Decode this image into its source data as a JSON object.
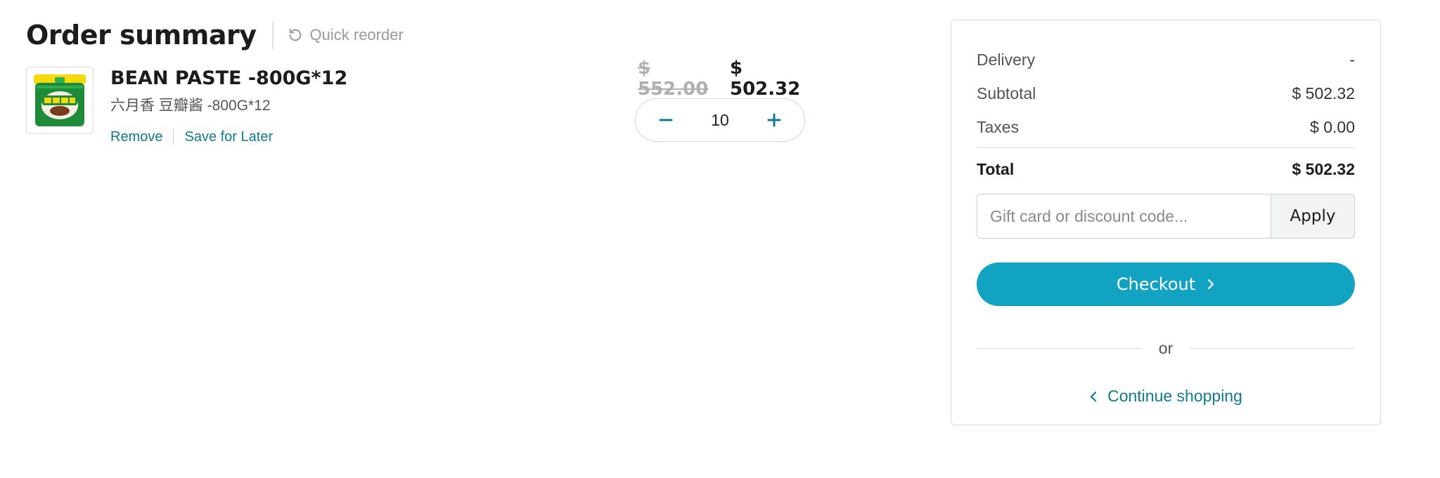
{
  "header": {
    "title": "Order summary",
    "quick_reorder_label": "Quick reorder",
    "reorder_icon": "refresh-icon"
  },
  "cart_items": [
    {
      "name": "BEAN PASTE -800G*12",
      "subtitle": "六月香 豆瓣酱 -800G*12",
      "original_price": "$ 552.00",
      "price": "$ 502.32",
      "quantity": "10",
      "remove_label": "Remove",
      "save_label": "Save for Later",
      "decrement_icon": "minus-icon",
      "increment_icon": "plus-icon"
    }
  ],
  "summary": {
    "delivery_label": "Delivery",
    "delivery_value": "-",
    "subtotal_label": "Subtotal",
    "subtotal_value": "$ 502.32",
    "taxes_label": "Taxes",
    "taxes_value": "$ 0.00",
    "total_label": "Total",
    "total_value": "$ 502.32",
    "discount_placeholder": "Gift card or discount code...",
    "apply_label": "Apply",
    "checkout_label": "Checkout",
    "or_label": "or",
    "continue_label": "Continue shopping"
  },
  "colors": {
    "accent": "#12a3c2",
    "link": "#0f7b8b",
    "product_green": "#1e8a3a",
    "product_lid": "#f5d90a"
  }
}
